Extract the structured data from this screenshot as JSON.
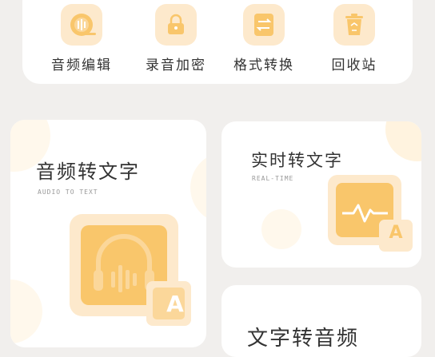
{
  "tools": [
    {
      "label": "音频编辑",
      "icon": "audio-edit-icon"
    },
    {
      "label": "录音加密",
      "icon": "lock-icon"
    },
    {
      "label": "格式转换",
      "icon": "convert-icon"
    },
    {
      "label": "回收站",
      "icon": "trash-icon"
    }
  ],
  "cards": {
    "audio_to_text": {
      "title": "音频转文字",
      "subtitle": "AUDIO TO TEXT"
    },
    "realtime": {
      "title": "实时转文字",
      "subtitle": "REAL-TIME"
    },
    "text_to_audio": {
      "title": "文字转音频"
    }
  },
  "badge_letter": "A",
  "colors": {
    "accent": "#f9c66b",
    "accent_light": "#fde9cc",
    "accent_mid": "#fbd79a",
    "background": "#f1efed",
    "text": "#333333"
  }
}
